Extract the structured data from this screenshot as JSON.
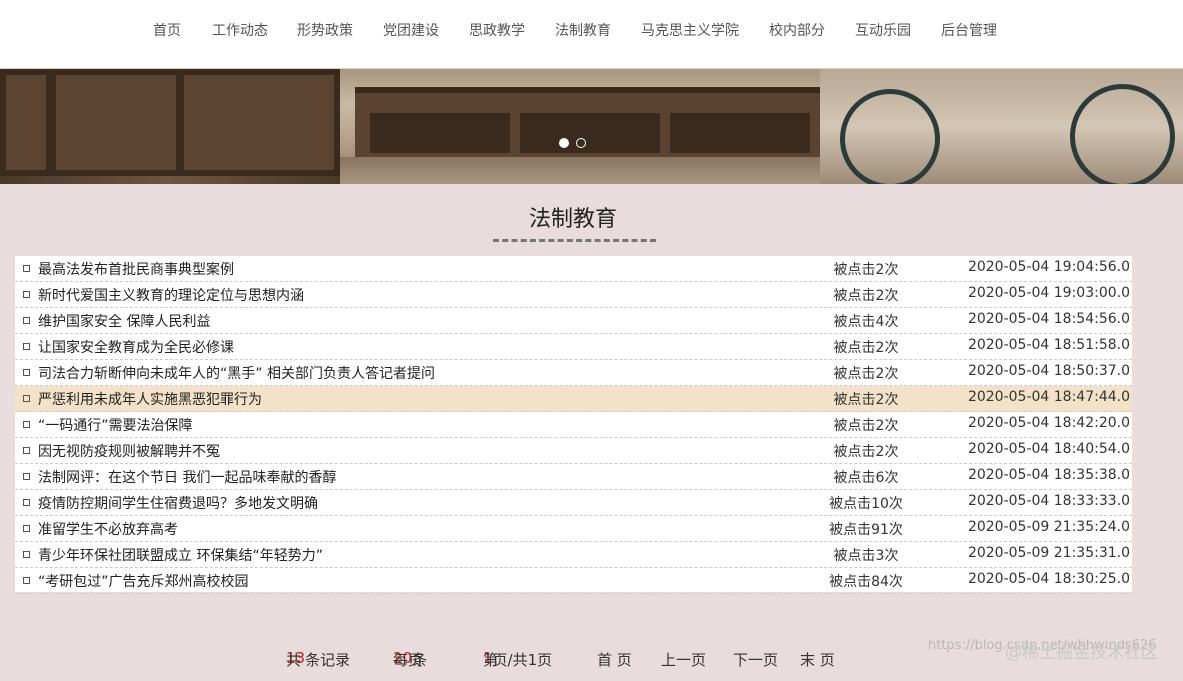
{
  "nav": {
    "items": [
      "首页",
      "工作动态",
      "形势政策",
      "党团建设",
      "思政教学",
      "法制教育",
      "马克思主义学院",
      "校内部分",
      "互动乐园",
      "后台管理"
    ]
  },
  "banner": {
    "slides": 2,
    "active_slide": 1
  },
  "page_title": "法制教育",
  "articles": [
    {
      "title": "最高法发布首批民商事典型案例",
      "clicks": "被点击2次",
      "date": "2020-05-04 19:04:56.0"
    },
    {
      "title": "新时代爱国主义教育的理论定位与思想内涵",
      "clicks": "被点击2次",
      "date": "2020-05-04 19:03:00.0"
    },
    {
      "title": "维护国家安全 保障人民利益",
      "clicks": "被点击4次",
      "date": "2020-05-04 18:54:56.0"
    },
    {
      "title": "让国家安全教育成为全民必修课",
      "clicks": "被点击2次",
      "date": "2020-05-04 18:51:58.0"
    },
    {
      "title": "司法合力斩断伸向未成年人的“黑手” 相关部门负责人答记者提问",
      "clicks": "被点击2次",
      "date": "2020-05-04 18:50:37.0"
    },
    {
      "title": "严惩利用未成年人实施黑恶犯罪行为",
      "clicks": "被点击2次",
      "date": "2020-05-04 18:47:44.0"
    },
    {
      "title": "“一码通行”需要法治保障",
      "clicks": "被点击2次",
      "date": "2020-05-04 18:42:20.0"
    },
    {
      "title": "因无视防疫规则被解聘并不冤",
      "clicks": "被点击2次",
      "date": "2020-05-04 18:40:54.0"
    },
    {
      "title": "法制网评：在这个节日 我们一起品味奉献的香醇",
      "clicks": "被点击6次",
      "date": "2020-05-04 18:35:38.0"
    },
    {
      "title": "疫情防控期间学生住宿费退吗？多地发文明确",
      "clicks": "被点击10次",
      "date": "2020-05-04 18:33:33.0"
    },
    {
      "title": "准留学生不必放弃高考",
      "clicks": "被点击91次",
      "date": "2020-05-09 21:35:24.0"
    },
    {
      "title": "青少年环保社团联盟成立 环保集结“年轻势力”",
      "clicks": "被点击3次",
      "date": "2020-05-09 21:35:31.0"
    },
    {
      "title": "“考研包过”广告充斥郑州高校校园",
      "clicks": "被点击84次",
      "date": "2020-05-04 18:30:25.0"
    }
  ],
  "highlighted_row": 5,
  "pager": {
    "total_prefix": "共",
    "total": "13",
    "total_suffix": "条记录",
    "per_page_prefix": "每页",
    "per_page": "20",
    "per_page_suffix": "条",
    "page_prefix": "第",
    "page": "1",
    "page_suffix": "页/共1页",
    "first": "首 页",
    "prev": "上一页",
    "next": "下一页",
    "last": "末 页"
  },
  "watermark": {
    "url": "https://blog.csdn.net/whhwinds626",
    "brand": "@稀土掘金技术社区"
  },
  "colors": {
    "accent_red": "#d4181f",
    "highlight": "#f3e2c8",
    "page_bg": "#e8dcdc"
  }
}
